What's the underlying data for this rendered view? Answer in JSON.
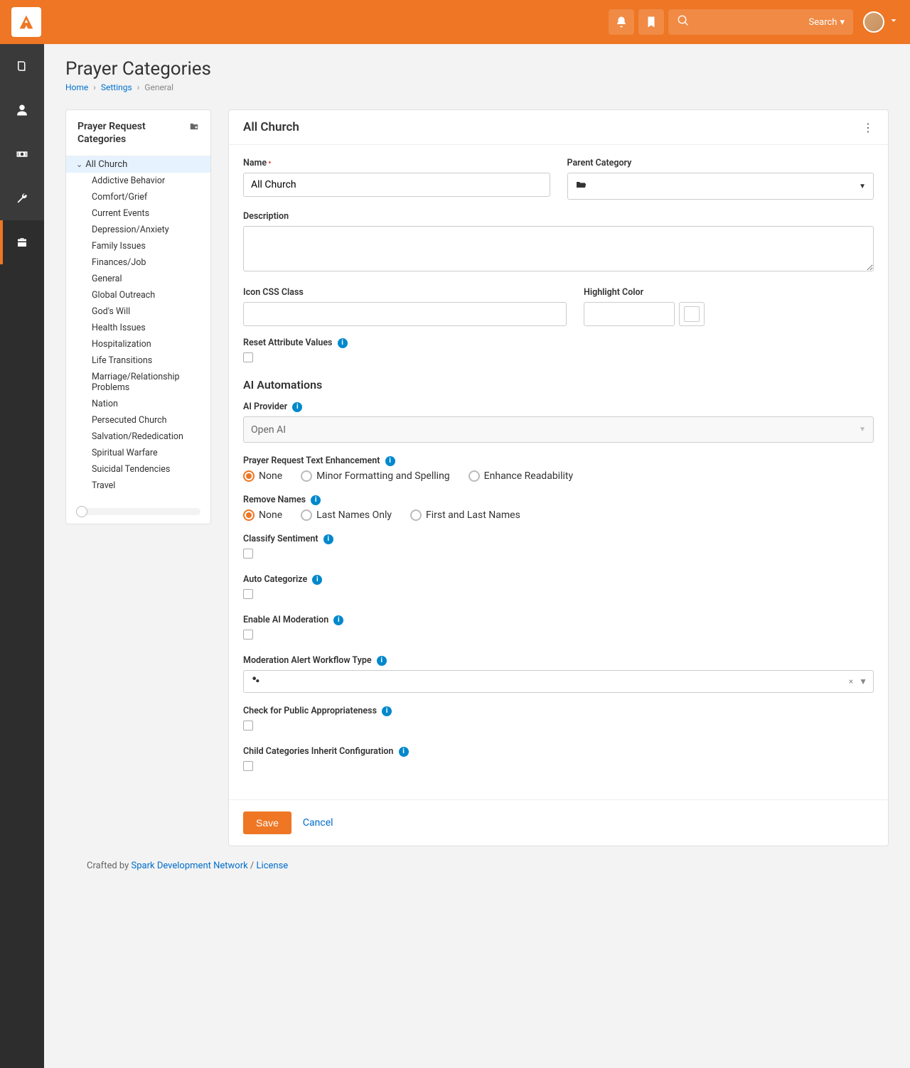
{
  "topbar": {
    "search_label": "Search"
  },
  "page": {
    "title": "Prayer Categories",
    "breadcrumb": {
      "home": "Home",
      "settings": "Settings",
      "current": "General"
    }
  },
  "sidepanel": {
    "title": "Prayer Request Categories",
    "root": "All Church",
    "items": [
      "Addictive Behavior",
      "Comfort/Grief",
      "Current Events",
      "Depression/Anxiety",
      "Family Issues",
      "Finances/Job",
      "General",
      "Global Outreach",
      "God's Will",
      "Health Issues",
      "Hospitalization",
      "Life Transitions",
      "Marriage/Relationship Problems",
      "Nation",
      "Persecuted Church",
      "Salvation/Rededication",
      "Spiritual Warfare",
      "Suicidal Tendencies",
      "Travel"
    ]
  },
  "editor": {
    "title": "All Church",
    "fields": {
      "name_label": "Name",
      "name_value": "All Church",
      "parent_label": "Parent Category",
      "description_label": "Description",
      "icon_css_label": "Icon CSS Class",
      "highlight_label": "Highlight Color",
      "reset_label": "Reset Attribute Values"
    },
    "ai": {
      "section_title": "AI Automations",
      "provider_label": "AI Provider",
      "provider_value": "Open AI",
      "text_enh_label": "Prayer Request Text Enhancement",
      "text_enh_options": [
        "None",
        "Minor Formatting and Spelling",
        "Enhance Readability"
      ],
      "remove_names_label": "Remove Names",
      "remove_names_options": [
        "None",
        "Last Names Only",
        "First and Last Names"
      ],
      "classify_label": "Classify Sentiment",
      "autocat_label": "Auto Categorize",
      "moderation_label": "Enable AI Moderation",
      "workflow_label": "Moderation Alert Workflow Type",
      "public_appr_label": "Check for Public Appropriateness",
      "inherit_label": "Child Categories Inherit Configuration"
    },
    "buttons": {
      "save": "Save",
      "cancel": "Cancel"
    }
  },
  "footer": {
    "crafted": "Crafted by ",
    "org": "Spark Development Network",
    "sep": " / ",
    "license": "License"
  }
}
